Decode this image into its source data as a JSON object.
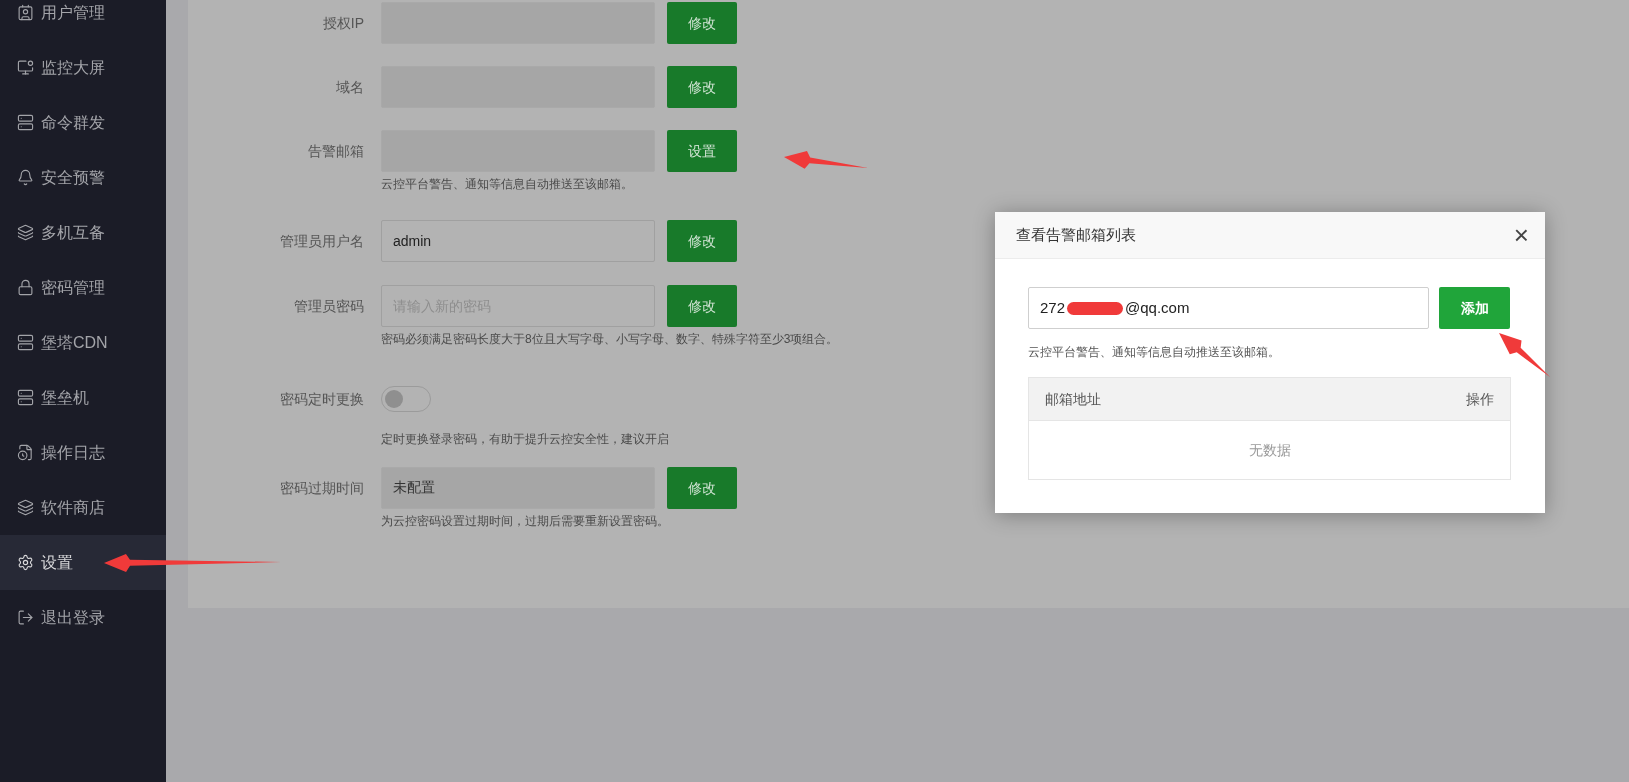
{
  "sidebar": {
    "items": [
      {
        "label": "用户管理",
        "selected": false
      },
      {
        "label": "监控大屏",
        "selected": false
      },
      {
        "label": "命令群发",
        "selected": false
      },
      {
        "label": "安全预警",
        "selected": false
      },
      {
        "label": "多机互备",
        "selected": false
      },
      {
        "label": "密码管理",
        "selected": false
      },
      {
        "label": "堡塔CDN",
        "selected": false
      },
      {
        "label": "堡垒机",
        "selected": false
      },
      {
        "label": "操作日志",
        "selected": false
      },
      {
        "label": "软件商店",
        "selected": false
      },
      {
        "label": "设置",
        "selected": true
      },
      {
        "label": "退出登录",
        "selected": false
      }
    ]
  },
  "settings": {
    "rows": [
      {
        "kind": "field",
        "label": "授权IP",
        "disabled": true,
        "button": "修改"
      },
      {
        "kind": "field",
        "label": "域名",
        "disabled": true,
        "button": "修改"
      },
      {
        "kind": "field",
        "label": "告警邮箱",
        "disabled": true,
        "button": "设置",
        "hint": "云控平台警告、通知等信息自动推送至该邮箱。"
      },
      {
        "kind": "field",
        "label": "管理员用户名",
        "disabled": false,
        "value": "admin",
        "button": "修改"
      },
      {
        "kind": "field",
        "label": "管理员密码",
        "disabled": false,
        "placeholder": "请输入新的密码",
        "button": "修改",
        "hint": "密码必须满足密码长度大于8位且大写字母、小写字母、数字、特殊字符至少3项组合。"
      },
      {
        "kind": "toggle",
        "label": "密码定时更换",
        "on": false,
        "hint": "定时更换登录密码，有助于提升云控安全性，建议开启"
      },
      {
        "kind": "field",
        "label": "密码过期时间",
        "disabled": true,
        "value": "未配置",
        "button": "修改",
        "hint": "为云控密码设置过期时间，过期后需要重新设置密码。"
      }
    ]
  },
  "dialog": {
    "title": "查看告警邮箱列表",
    "close": "×",
    "email_field": {
      "value_start": "272",
      "redacted": true,
      "value_end": "@qq.com"
    },
    "add_button": "添加",
    "hint": "云控平台警告、通知等信息自动推送至该邮箱。",
    "table": {
      "columns": [
        "邮箱地址",
        "操作"
      ],
      "empty_text": "无数据"
    }
  }
}
